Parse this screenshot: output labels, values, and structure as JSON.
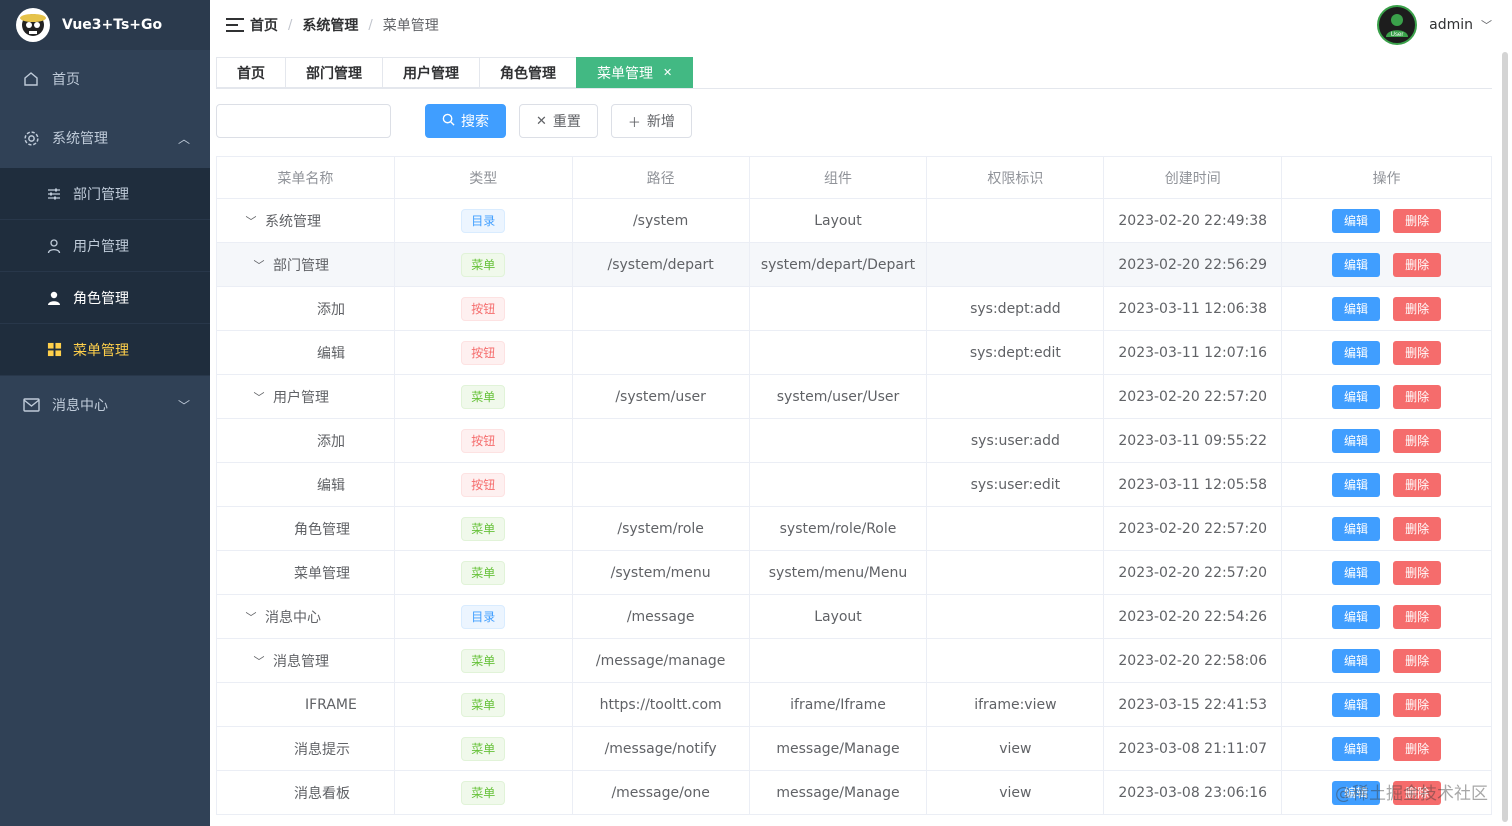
{
  "sidebar": {
    "app_name": "Vue3+Ts+Go",
    "items": {
      "home": "首页",
      "system": "系统管理",
      "dept": "部门管理",
      "user": "用户管理",
      "role": "角色管理",
      "menu": "菜单管理",
      "message": "消息中心"
    }
  },
  "header": {
    "breadcrumb": [
      "首页",
      "系统管理",
      "菜单管理"
    ],
    "username": "admin",
    "avatar_text": "User"
  },
  "tags": [
    "首页",
    "部门管理",
    "用户管理",
    "角色管理",
    "菜单管理"
  ],
  "toolbar": {
    "search_value": "",
    "search": "搜索",
    "reset": "重置",
    "add": "新增"
  },
  "table": {
    "columns": [
      "菜单名称",
      "类型",
      "路径",
      "组件",
      "权限标识",
      "创建时间",
      "操作"
    ],
    "edit_label": "编辑",
    "delete_label": "删除",
    "rows": [
      {
        "name": "系统管理",
        "type": "目录",
        "path": "/system",
        "component": "Layout",
        "perm": "",
        "created": "2023-02-20 22:49:38"
      },
      {
        "name": "部门管理",
        "type": "菜单",
        "path": "/system/depart",
        "component": "system/depart/Depart",
        "perm": "",
        "created": "2023-02-20 22:56:29"
      },
      {
        "name": "添加",
        "type": "按钮",
        "path": "",
        "component": "",
        "perm": "sys:dept:add",
        "created": "2023-03-11 12:06:38"
      },
      {
        "name": "编辑",
        "type": "按钮",
        "path": "",
        "component": "",
        "perm": "sys:dept:edit",
        "created": "2023-03-11 12:07:16"
      },
      {
        "name": "用户管理",
        "type": "菜单",
        "path": "/system/user",
        "component": "system/user/User",
        "perm": "",
        "created": "2023-02-20 22:57:20"
      },
      {
        "name": "添加",
        "type": "按钮",
        "path": "",
        "component": "",
        "perm": "sys:user:add",
        "created": "2023-03-11 09:55:22"
      },
      {
        "name": "编辑",
        "type": "按钮",
        "path": "",
        "component": "",
        "perm": "sys:user:edit",
        "created": "2023-03-11 12:05:58"
      },
      {
        "name": "角色管理",
        "type": "菜单",
        "path": "/system/role",
        "component": "system/role/Role",
        "perm": "",
        "created": "2023-02-20 22:57:20"
      },
      {
        "name": "菜单管理",
        "type": "菜单",
        "path": "/system/menu",
        "component": "system/menu/Menu",
        "perm": "",
        "created": "2023-02-20 22:57:20"
      },
      {
        "name": "消息中心",
        "type": "目录",
        "path": "/message",
        "component": "Layout",
        "perm": "",
        "created": "2023-02-20 22:54:26"
      },
      {
        "name": "消息管理",
        "type": "菜单",
        "path": "/message/manage",
        "component": "",
        "perm": "",
        "created": "2023-02-20 22:58:06"
      },
      {
        "name": "IFRAME",
        "type": "菜单",
        "path": "https://tooltt.com",
        "component": "iframe/Iframe",
        "perm": "iframe:view",
        "created": "2023-03-15 22:41:53"
      },
      {
        "name": "消息提示",
        "type": "菜单",
        "path": "/message/notify",
        "component": "message/Manage",
        "perm": "view",
        "created": "2023-03-08 21:11:07"
      },
      {
        "name": "消息看板",
        "type": "菜单",
        "path": "/message/one",
        "component": "message/Manage",
        "perm": "view",
        "created": "2023-03-08 23:06:16"
      }
    ]
  },
  "watermark": "@稀土掘金技术社区",
  "colors": {
    "sidebar_bg": "#304156",
    "active_menu": "#ffd04b",
    "active_tag": "#42b983",
    "primary": "#409eff",
    "danger": "#f56c6c"
  }
}
